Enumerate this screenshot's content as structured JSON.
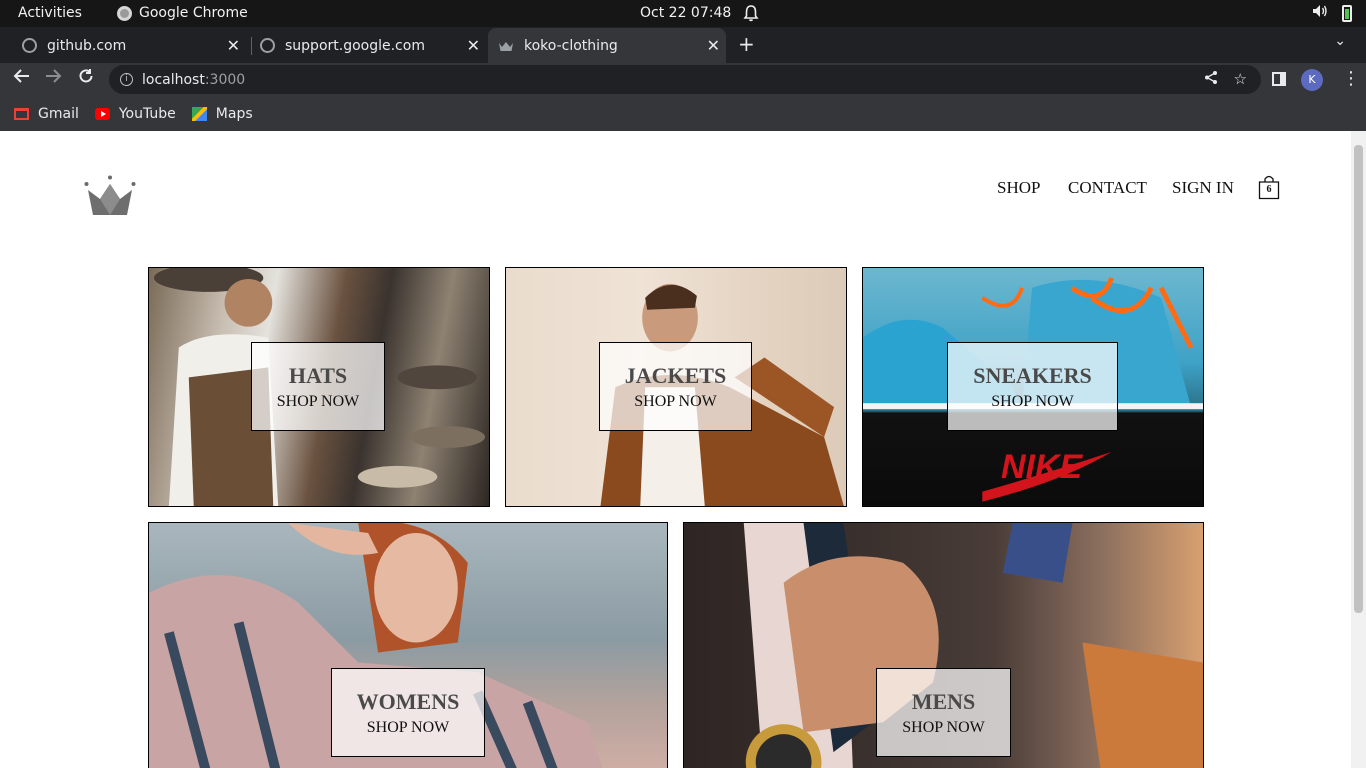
{
  "system_bar": {
    "activities": "Activities",
    "app_name": "Google Chrome",
    "clock": "Oct 22  07:48"
  },
  "browser": {
    "tabs": [
      {
        "title": "github.com",
        "icon": "globe-icon",
        "active": false
      },
      {
        "title": "support.google.com",
        "icon": "globe-icon",
        "active": false
      },
      {
        "title": "koko-clothing",
        "icon": "crown-icon",
        "active": true
      }
    ],
    "address": {
      "host": "localhost",
      "port": ":3000"
    },
    "profile_initial": "K",
    "bookmarks": [
      {
        "label": "Gmail",
        "icon": "gmail-icon"
      },
      {
        "label": "YouTube",
        "icon": "youtube-icon"
      },
      {
        "label": "Maps",
        "icon": "maps-icon"
      }
    ]
  },
  "site": {
    "nav": {
      "shop": "SHOP",
      "contact": "CONTACT",
      "sign_in": "SIGN IN"
    },
    "cart_count": "6",
    "categories": [
      {
        "title": "HATS",
        "cta": "SHOP NOW"
      },
      {
        "title": "JACKETS",
        "cta": "SHOP NOW"
      },
      {
        "title": "SNEAKERS",
        "cta": "SHOP NOW"
      },
      {
        "title": "WOMENS",
        "cta": "SHOP NOW"
      },
      {
        "title": "MENS",
        "cta": "SHOP NOW"
      }
    ],
    "sneaker_brand": "NIKE"
  },
  "colors": {
    "system_bar": "#161616",
    "tab_strip": "#202124",
    "toolbar": "#35363a",
    "logo_gray": "#6b6b6b"
  }
}
